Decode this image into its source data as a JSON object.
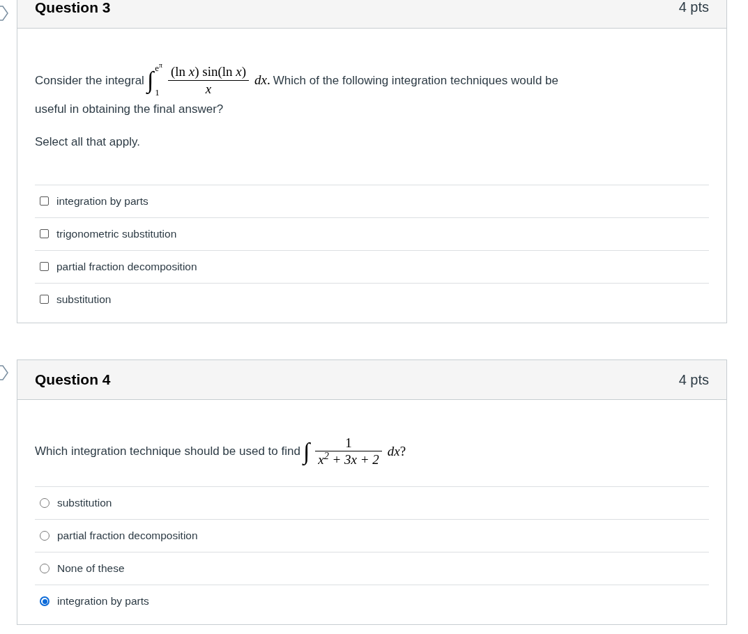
{
  "questions": [
    {
      "title": "Question 3",
      "points": "4 pts",
      "kind": "checkbox",
      "prompt_before": "Consider the integral",
      "math": {
        "kind": "definite",
        "sign": "∫",
        "upper": "e$^{π}$",
        "lower": "1",
        "numerator": "(ln *x*) sin(ln *x*)",
        "denominator": "*x*",
        "differential": "*dx*."
      },
      "prompt_after": "Which of the following integration techniques would be",
      "prompt_continued": "useful in obtaining the final answer?",
      "instruction": "Select all that apply.",
      "options": [
        {
          "label": "integration by parts",
          "selected": false
        },
        {
          "label": "trigonometric substitution",
          "selected": false
        },
        {
          "label": "partial fraction decomposition",
          "selected": false
        },
        {
          "label": "substitution",
          "selected": false
        }
      ]
    },
    {
      "title": "Question 4",
      "points": "4 pts",
      "kind": "radio",
      "prompt_before": "Which integration technique should be used to find",
      "math": {
        "kind": "indefinite",
        "sign": "∫",
        "numerator": "1",
        "denominator": "x$^{2}$ + 3x + 2",
        "differential": "*dx*?"
      },
      "options": [
        {
          "label": "substitution",
          "selected": false
        },
        {
          "label": "partial fraction decomposition",
          "selected": false
        },
        {
          "label": "None of these",
          "selected": false
        },
        {
          "label": "integration by parts",
          "selected": true
        }
      ]
    }
  ]
}
